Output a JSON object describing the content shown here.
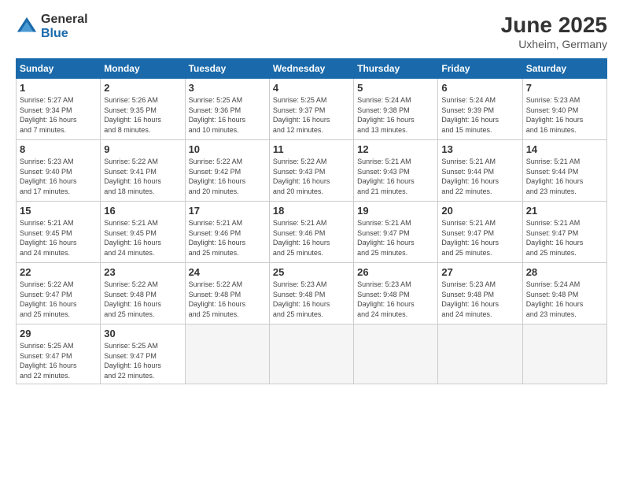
{
  "logo": {
    "general": "General",
    "blue": "Blue"
  },
  "title": "June 2025",
  "location": "Uxheim, Germany",
  "headers": [
    "Sunday",
    "Monday",
    "Tuesday",
    "Wednesday",
    "Thursday",
    "Friday",
    "Saturday"
  ],
  "weeks": [
    [
      {
        "day": "1",
        "info": "Sunrise: 5:27 AM\nSunset: 9:34 PM\nDaylight: 16 hours\nand 7 minutes."
      },
      {
        "day": "2",
        "info": "Sunrise: 5:26 AM\nSunset: 9:35 PM\nDaylight: 16 hours\nand 8 minutes."
      },
      {
        "day": "3",
        "info": "Sunrise: 5:25 AM\nSunset: 9:36 PM\nDaylight: 16 hours\nand 10 minutes."
      },
      {
        "day": "4",
        "info": "Sunrise: 5:25 AM\nSunset: 9:37 PM\nDaylight: 16 hours\nand 12 minutes."
      },
      {
        "day": "5",
        "info": "Sunrise: 5:24 AM\nSunset: 9:38 PM\nDaylight: 16 hours\nand 13 minutes."
      },
      {
        "day": "6",
        "info": "Sunrise: 5:24 AM\nSunset: 9:39 PM\nDaylight: 16 hours\nand 15 minutes."
      },
      {
        "day": "7",
        "info": "Sunrise: 5:23 AM\nSunset: 9:40 PM\nDaylight: 16 hours\nand 16 minutes."
      }
    ],
    [
      {
        "day": "8",
        "info": "Sunrise: 5:23 AM\nSunset: 9:40 PM\nDaylight: 16 hours\nand 17 minutes."
      },
      {
        "day": "9",
        "info": "Sunrise: 5:22 AM\nSunset: 9:41 PM\nDaylight: 16 hours\nand 18 minutes."
      },
      {
        "day": "10",
        "info": "Sunrise: 5:22 AM\nSunset: 9:42 PM\nDaylight: 16 hours\nand 20 minutes."
      },
      {
        "day": "11",
        "info": "Sunrise: 5:22 AM\nSunset: 9:43 PM\nDaylight: 16 hours\nand 20 minutes."
      },
      {
        "day": "12",
        "info": "Sunrise: 5:21 AM\nSunset: 9:43 PM\nDaylight: 16 hours\nand 21 minutes."
      },
      {
        "day": "13",
        "info": "Sunrise: 5:21 AM\nSunset: 9:44 PM\nDaylight: 16 hours\nand 22 minutes."
      },
      {
        "day": "14",
        "info": "Sunrise: 5:21 AM\nSunset: 9:44 PM\nDaylight: 16 hours\nand 23 minutes."
      }
    ],
    [
      {
        "day": "15",
        "info": "Sunrise: 5:21 AM\nSunset: 9:45 PM\nDaylight: 16 hours\nand 24 minutes."
      },
      {
        "day": "16",
        "info": "Sunrise: 5:21 AM\nSunset: 9:45 PM\nDaylight: 16 hours\nand 24 minutes."
      },
      {
        "day": "17",
        "info": "Sunrise: 5:21 AM\nSunset: 9:46 PM\nDaylight: 16 hours\nand 25 minutes."
      },
      {
        "day": "18",
        "info": "Sunrise: 5:21 AM\nSunset: 9:46 PM\nDaylight: 16 hours\nand 25 minutes."
      },
      {
        "day": "19",
        "info": "Sunrise: 5:21 AM\nSunset: 9:47 PM\nDaylight: 16 hours\nand 25 minutes."
      },
      {
        "day": "20",
        "info": "Sunrise: 5:21 AM\nSunset: 9:47 PM\nDaylight: 16 hours\nand 25 minutes."
      },
      {
        "day": "21",
        "info": "Sunrise: 5:21 AM\nSunset: 9:47 PM\nDaylight: 16 hours\nand 25 minutes."
      }
    ],
    [
      {
        "day": "22",
        "info": "Sunrise: 5:22 AM\nSunset: 9:47 PM\nDaylight: 16 hours\nand 25 minutes."
      },
      {
        "day": "23",
        "info": "Sunrise: 5:22 AM\nSunset: 9:48 PM\nDaylight: 16 hours\nand 25 minutes."
      },
      {
        "day": "24",
        "info": "Sunrise: 5:22 AM\nSunset: 9:48 PM\nDaylight: 16 hours\nand 25 minutes."
      },
      {
        "day": "25",
        "info": "Sunrise: 5:23 AM\nSunset: 9:48 PM\nDaylight: 16 hours\nand 25 minutes."
      },
      {
        "day": "26",
        "info": "Sunrise: 5:23 AM\nSunset: 9:48 PM\nDaylight: 16 hours\nand 24 minutes."
      },
      {
        "day": "27",
        "info": "Sunrise: 5:23 AM\nSunset: 9:48 PM\nDaylight: 16 hours\nand 24 minutes."
      },
      {
        "day": "28",
        "info": "Sunrise: 5:24 AM\nSunset: 9:48 PM\nDaylight: 16 hours\nand 23 minutes."
      }
    ],
    [
      {
        "day": "29",
        "info": "Sunrise: 5:25 AM\nSunset: 9:47 PM\nDaylight: 16 hours\nand 22 minutes."
      },
      {
        "day": "30",
        "info": "Sunrise: 5:25 AM\nSunset: 9:47 PM\nDaylight: 16 hours\nand 22 minutes."
      },
      {
        "day": "",
        "info": ""
      },
      {
        "day": "",
        "info": ""
      },
      {
        "day": "",
        "info": ""
      },
      {
        "day": "",
        "info": ""
      },
      {
        "day": "",
        "info": ""
      }
    ]
  ]
}
